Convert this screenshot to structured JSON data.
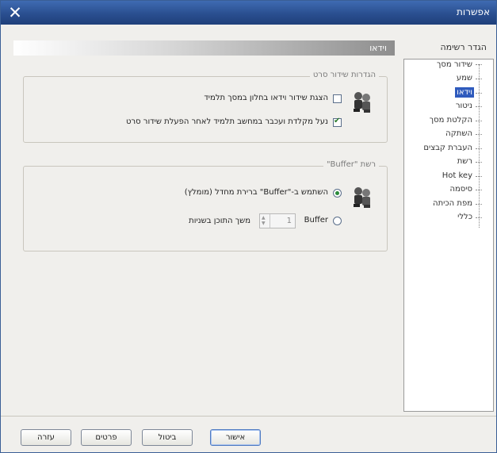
{
  "window": {
    "title": "אפשרות",
    "close_glyph": "✕"
  },
  "nav": {
    "header": "הגדר רשימה",
    "items": [
      {
        "label": "שידור מסך",
        "selected": false
      },
      {
        "label": "שמע",
        "selected": false
      },
      {
        "label": "וידאו",
        "selected": true
      },
      {
        "label": "ניטור",
        "selected": false
      },
      {
        "label": "הקלטת מסך",
        "selected": false
      },
      {
        "label": "השתקה",
        "selected": false
      },
      {
        "label": "העברת קבצים",
        "selected": false
      },
      {
        "label": "רשת",
        "selected": false
      },
      {
        "label": "Hot key",
        "selected": false
      },
      {
        "label": "סיסמה",
        "selected": false
      },
      {
        "label": "מפת הכיתה",
        "selected": false
      },
      {
        "label": "כללי",
        "selected": false
      }
    ]
  },
  "section": {
    "title": "וידאו"
  },
  "group1": {
    "label": "הגדרות שידור סרט",
    "options": [
      {
        "label": "הצגת שידור וידאו בחלון במסך תלמיד",
        "checked": false
      },
      {
        "label": "נעל מקלדת ועכבר במחשב תלמיד לאחר הפעלת שידור סרט",
        "checked": true
      }
    ]
  },
  "group2": {
    "label": "רשת \"Buffer\"",
    "radio_default": "השתמש ב-\"Buffer\" ברירת מחדל (מומלץ)",
    "radio_buffer": "Buffer",
    "duration_label": "משך התוכן בשניות",
    "spin_value": "1"
  },
  "buttons": {
    "ok": "אישור",
    "cancel": "ביטול",
    "details": "פרטים",
    "help": "עזרה"
  },
  "icons": {
    "group_icon": "users-icon",
    "close": "close-icon"
  }
}
